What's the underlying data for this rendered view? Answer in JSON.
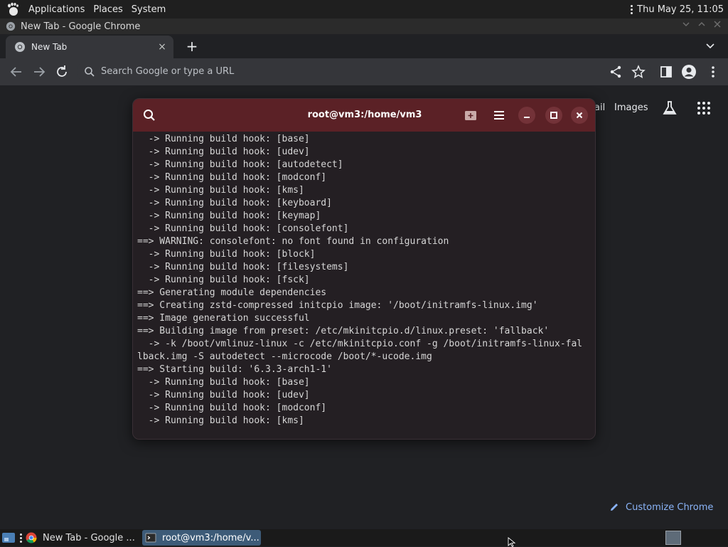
{
  "top_panel": {
    "menus": [
      "Applications",
      "Places",
      "System"
    ],
    "clock": "Thu May 25, 11:05"
  },
  "chrome": {
    "window_title": "New Tab - Google Chrome",
    "tab": {
      "title": "New Tab",
      "close": "×"
    },
    "new_tab": "+",
    "omnibox_placeholder": "Search Google or type a URL",
    "ntp": {
      "gmail_partial": "ail",
      "images": "Images",
      "customize": "Customize Chrome"
    }
  },
  "terminal": {
    "title": "root@vm3:/home/vm3",
    "lines": [
      "  -> Running build hook: [base]",
      "  -> Running build hook: [udev]",
      "  -> Running build hook: [autodetect]",
      "  -> Running build hook: [modconf]",
      "  -> Running build hook: [kms]",
      "  -> Running build hook: [keyboard]",
      "  -> Running build hook: [keymap]",
      "  -> Running build hook: [consolefont]",
      "==> WARNING: consolefont: no font found in configuration",
      "  -> Running build hook: [block]",
      "  -> Running build hook: [filesystems]",
      "  -> Running build hook: [fsck]",
      "==> Generating module dependencies",
      "==> Creating zstd-compressed initcpio image: '/boot/initramfs-linux.img'",
      "==> Image generation successful",
      "==> Building image from preset: /etc/mkinitcpio.d/linux.preset: 'fallback'",
      "  -> -k /boot/vmlinuz-linux -c /etc/mkinitcpio.conf -g /boot/initramfs-linux-fal",
      "lback.img -S autodetect --microcode /boot/*-ucode.img",
      "==> Starting build: '6.3.3-arch1-1'",
      "  -> Running build hook: [base]",
      "  -> Running build hook: [udev]",
      "  -> Running build hook: [modconf]",
      "  -> Running build hook: [kms]"
    ]
  },
  "taskbar": {
    "chrome_label": "New Tab - Google ...",
    "terminal_label": "root@vm3:/home/v..."
  },
  "colors": {
    "terminal_header": "#5b2126",
    "terminal_bg": "#241f23",
    "taskbar_active": "#3d5b78",
    "link_blue": "#8ab4f8"
  },
  "icons": [
    "gnome-foot-icon",
    "chrome-icon",
    "search-icon",
    "back-arrow-icon",
    "forward-arrow-icon",
    "reload-icon",
    "share-icon",
    "star-icon",
    "side-panel-icon",
    "profile-icon",
    "more-vert-icon",
    "labs-icon",
    "apps-grid-icon",
    "pencil-icon",
    "hamburger-menu-icon",
    "minimize-icon",
    "maximize-icon",
    "close-icon",
    "terminal-icon"
  ]
}
